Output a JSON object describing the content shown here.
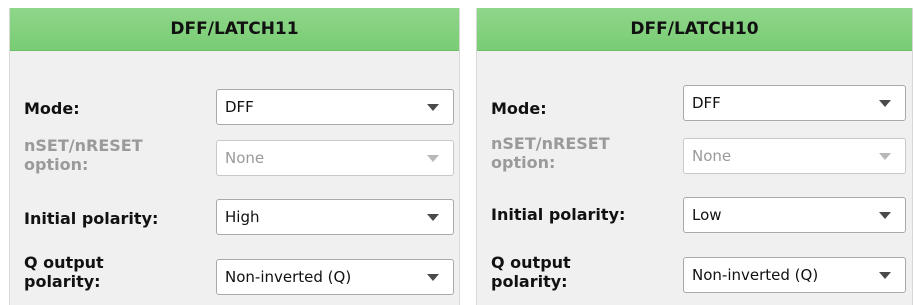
{
  "panels": [
    {
      "title": "DFF/LATCH11",
      "mode_label": "Mode:",
      "mode_value": "DFF",
      "nset_label_line1": "nSET/nRESET",
      "nset_label_line2": "option:",
      "nset_value": "None",
      "initial_polarity_label": "Initial polarity:",
      "initial_polarity_value": "High",
      "q_output_label_line1": "Q output",
      "q_output_label_line2": "polarity:",
      "q_output_value": "Non-inverted (Q)"
    },
    {
      "title": "DFF/LATCH10",
      "mode_label": "Mode:",
      "mode_value": "DFF",
      "nset_label_line1": "nSET/nRESET",
      "nset_label_line2": "option:",
      "nset_value": "None",
      "initial_polarity_label": "Initial polarity:",
      "initial_polarity_value": "Low",
      "q_output_label_line1": "Q output",
      "q_output_label_line2": "polarity:",
      "q_output_value": "Non-inverted (Q)"
    }
  ],
  "colors": {
    "header_green": "#7fcf7a",
    "panel_bg": "#f0f0f0",
    "disabled_text": "#9a9a9a"
  },
  "icons": {
    "dropdown": "chevron-down-icon"
  }
}
